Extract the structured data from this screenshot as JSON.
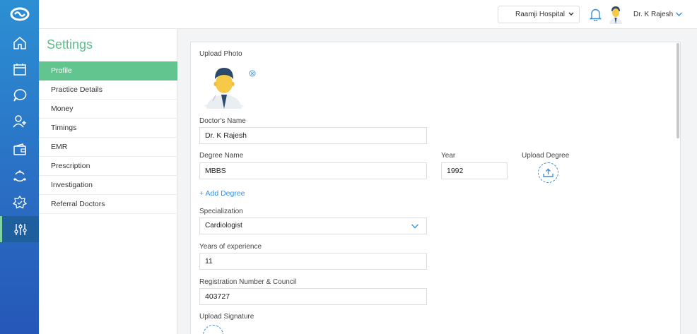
{
  "header": {
    "hospital_select": "Raamji Hospital",
    "user_name": "Dr. K Rajesh"
  },
  "rail": {
    "items": [
      {
        "icon": "home-icon"
      },
      {
        "icon": "calendar-icon"
      },
      {
        "icon": "chat-icon"
      },
      {
        "icon": "add-user-icon"
      },
      {
        "icon": "wallet-icon"
      },
      {
        "icon": "cycle-icon"
      },
      {
        "icon": "badge-icon"
      },
      {
        "icon": "sliders-icon",
        "active": true
      }
    ]
  },
  "settings": {
    "title": "Settings",
    "menu": [
      {
        "label": "Profile",
        "active": true
      },
      {
        "label": "Practice Details"
      },
      {
        "label": "Money"
      },
      {
        "label": "Timings"
      },
      {
        "label": "EMR"
      },
      {
        "label": "Prescription"
      },
      {
        "label": "Investigation"
      },
      {
        "label": "Referral Doctors"
      }
    ]
  },
  "form": {
    "upload_photo_label": "Upload Photo",
    "doctor_name_label": "Doctor's Name",
    "doctor_name_value": "Dr. K Rajesh",
    "degree_name_label": "Degree Name",
    "degree_name_value": "MBBS",
    "year_label": "Year",
    "year_value": "1992",
    "upload_degree_label": "Upload Degree",
    "add_degree_link": "+ Add Degree",
    "specialization_label": "Specialization",
    "specialization_value": "Cardiologist",
    "experience_label": "Years of experience",
    "experience_value": "11",
    "registration_label": "Registration Number & Council",
    "registration_value": "403727",
    "upload_signature_label": "Upload Signature"
  },
  "colors": {
    "accent_green": "#62c48f",
    "link_blue": "#3b8ed8",
    "rail_blue": "#2a6fc4"
  }
}
